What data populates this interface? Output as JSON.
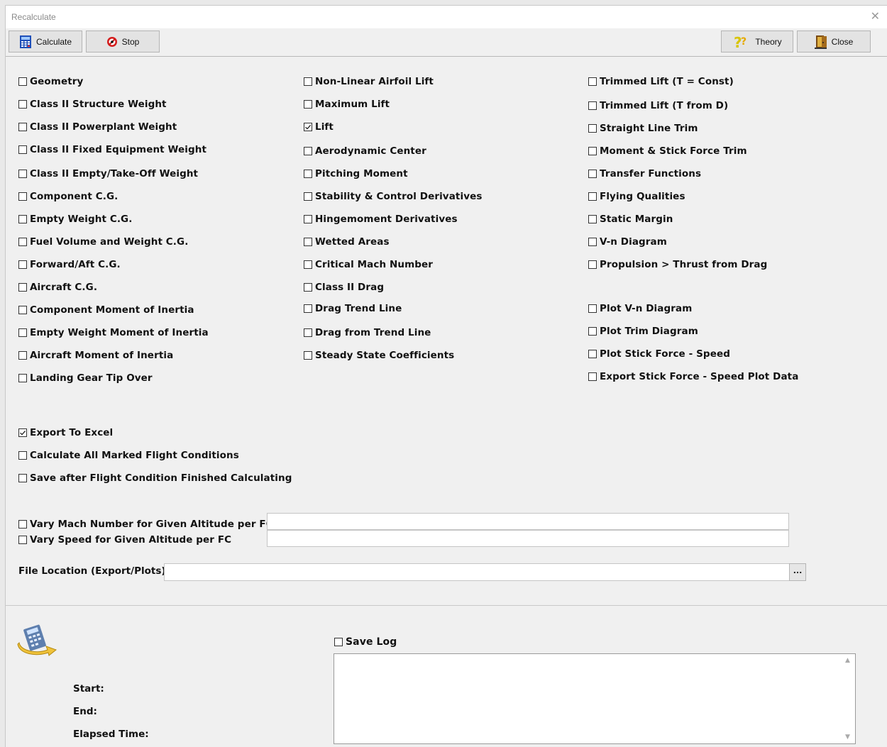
{
  "window": {
    "title": "Recalculate",
    "close_glyph": "✕"
  },
  "toolbar": {
    "calculate": "Calculate",
    "stop": "Stop",
    "theory": "Theory",
    "close": "Close"
  },
  "col1": [
    {
      "label": "Geometry",
      "checked": false
    },
    {
      "label": "Class II Structure Weight",
      "checked": false
    },
    {
      "label": "Class II Powerplant Weight",
      "checked": false
    },
    {
      "label": "Class II Fixed Equipment Weight",
      "checked": false
    },
    {
      "label": "Class II Empty/Take-Off Weight",
      "checked": false
    },
    {
      "label": "Component C.G.",
      "checked": false
    },
    {
      "label": "Empty Weight C.G.",
      "checked": false
    },
    {
      "label": "Fuel Volume and Weight C.G.",
      "checked": false
    },
    {
      "label": "Forward/Aft C.G.",
      "checked": false
    },
    {
      "label": "Aircraft C.G.",
      "checked": false
    },
    {
      "label": "Component Moment of Inertia",
      "checked": false
    },
    {
      "label": "Empty Weight Moment of Inertia",
      "checked": false
    },
    {
      "label": "Aircraft Moment of Inertia",
      "checked": false
    },
    {
      "label": "Landing Gear Tip Over",
      "checked": false
    }
  ],
  "col2": [
    {
      "label": "Non-Linear Airfoil Lift",
      "checked": false
    },
    {
      "label": "Maximum Lift",
      "checked": false
    },
    {
      "label": "Lift",
      "checked": true
    },
    {
      "label": "Aerodynamic Center",
      "checked": false
    },
    {
      "label": "Pitching Moment",
      "checked": false
    },
    {
      "label": "Stability & Control Derivatives",
      "checked": false
    },
    {
      "label": "Hingemoment Derivatives",
      "checked": false
    },
    {
      "label": "Wetted Areas",
      "checked": false
    },
    {
      "label": "Critical Mach Number",
      "checked": false
    },
    {
      "label": "Class II Drag",
      "checked": false
    },
    {
      "label": "Drag Trend Line",
      "checked": false
    },
    {
      "label": "Drag from Trend Line",
      "checked": false
    },
    {
      "label": "Steady State Coefficients",
      "checked": false
    }
  ],
  "col3": [
    {
      "label": "Trimmed Lift (T = Const)",
      "checked": false
    },
    {
      "label": "Trimmed Lift (T from D)",
      "checked": false
    },
    {
      "label": "Straight Line Trim",
      "checked": false
    },
    {
      "label": "Moment & Stick Force Trim",
      "checked": false
    },
    {
      "label": "Transfer Functions",
      "checked": false
    },
    {
      "label": "Flying Qualities",
      "checked": false
    },
    {
      "label": "Static Margin",
      "checked": false
    },
    {
      "label": "V-n Diagram",
      "checked": false
    },
    {
      "label": "Propulsion > Thrust from Drag",
      "checked": false
    },
    {
      "label": "Plot V-n Diagram",
      "checked": false
    },
    {
      "label": "Plot Trim Diagram",
      "checked": false
    },
    {
      "label": "Plot Stick Force - Speed",
      "checked": false
    },
    {
      "label": "Export Stick Force - Speed Plot Data",
      "checked": false
    }
  ],
  "options": [
    {
      "label": "Export To Excel",
      "checked": true
    },
    {
      "label": "Calculate All Marked Flight Conditions",
      "checked": false
    },
    {
      "label": "Save after Flight Condition Finished Calculating",
      "checked": false
    }
  ],
  "vary": [
    {
      "label": "Vary Mach Number for Given Altitude per FC",
      "checked": false,
      "value": ""
    },
    {
      "label": "Vary Speed for Given Altitude per FC",
      "checked": false,
      "value": ""
    }
  ],
  "file_location": {
    "label": "File Location (Export/Plots)",
    "value": "",
    "browse": "..."
  },
  "log": {
    "save_log": {
      "label": "Save Log",
      "checked": false
    },
    "start_label": "Start:",
    "end_label": "End:",
    "elapsed_label": "Elapsed Time:",
    "content": ""
  },
  "icons": {
    "calculate": "calculator-icon",
    "stop": "stop-icon",
    "theory": "question-icon",
    "close": "door-exit-icon",
    "recalc": "recalculate-icon"
  }
}
